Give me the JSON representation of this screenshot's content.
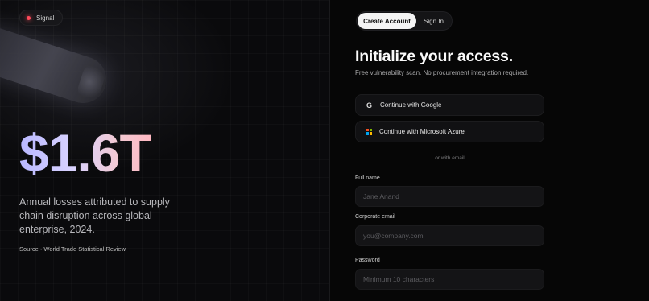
{
  "left_panel": {
    "signal_label": "Signal",
    "big_number": "$1.6T",
    "tagline": "Annual losses attributed to supply chain disruption across global enterprise, 2024.",
    "source": "Source · World Trade Statistical Review"
  },
  "auth": {
    "tabs": {
      "create_account": "Create Account",
      "sign_in": "Sign In",
      "active": "Create Account"
    },
    "heading": "Initialize your access.",
    "subheading": "Free vulnerability scan. No procurement integration required.",
    "google_button": "Continue with Google",
    "microsoft_button": "Continue with Microsoft Azure",
    "google_icon_glyph": "G",
    "or_divider": "or with email",
    "fields": {
      "full_name": {
        "label": "Full name",
        "placeholder": "Jane Anand",
        "value": ""
      },
      "email": {
        "label": "Corporate email",
        "placeholder": "you@company.com",
        "value": ""
      },
      "password": {
        "label": "Password",
        "placeholder": "Minimum 10 characters",
        "value": ""
      }
    }
  },
  "colors": {
    "background": "#050505",
    "signal_dot": "#ff4a5a",
    "gradient_start": "#b9b8ff",
    "gradient_end": "#ffb8c2",
    "active_tab": "#f4f4f4"
  },
  "icons": [
    "signal-dot-icon",
    "google-icon",
    "microsoft-icon"
  ]
}
